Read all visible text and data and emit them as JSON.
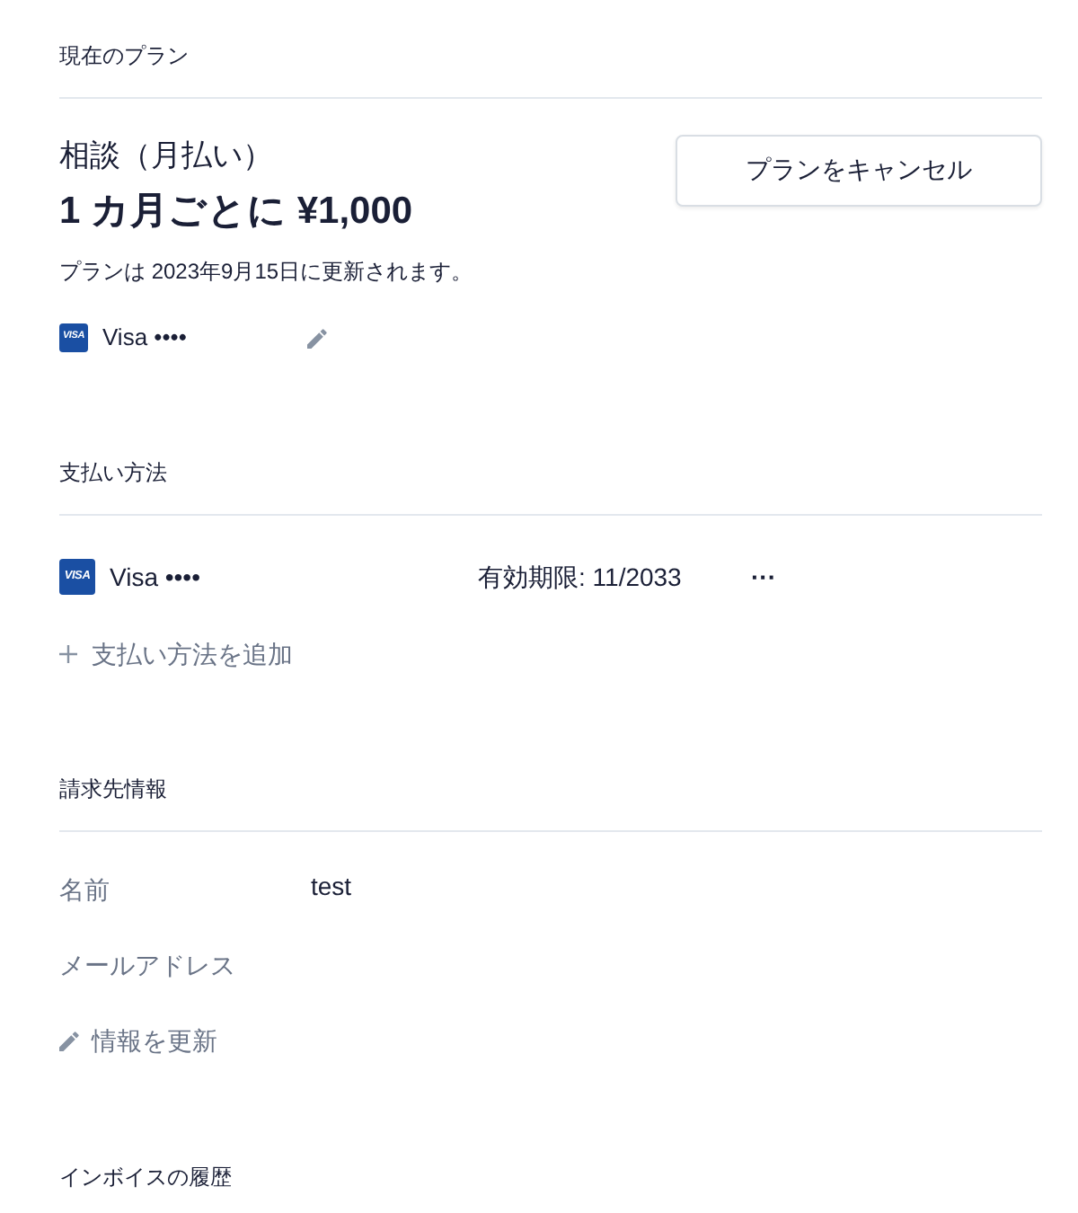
{
  "sections": [
    {
      "kind": "plan",
      "title": "現在のプラン",
      "plan_name": "相談（月払い）",
      "price": "1 カ月ごとに ¥1,000",
      "renewal": "プランは 2023年9月15日に更新されます。",
      "card": {
        "logo": "VISA",
        "label": "Visa ••••"
      },
      "cancel_button": "プランをキャンセル"
    },
    {
      "kind": "payment",
      "title": "支払い方法",
      "methods": [
        {
          "logo": "VISA",
          "label": "Visa ••••",
          "expiry": "有効期限: 11/2033",
          "menu": "···"
        }
      ],
      "add_link": "支払い方法を追加"
    },
    {
      "kind": "billing",
      "title": "請求先情報",
      "fields": [
        {
          "label": "名前",
          "value": "test"
        },
        {
          "label": "メールアドレス"
        }
      ],
      "update_link": "情報を更新"
    },
    {
      "kind": "invoices",
      "title": "インボイスの履歴"
    }
  ]
}
